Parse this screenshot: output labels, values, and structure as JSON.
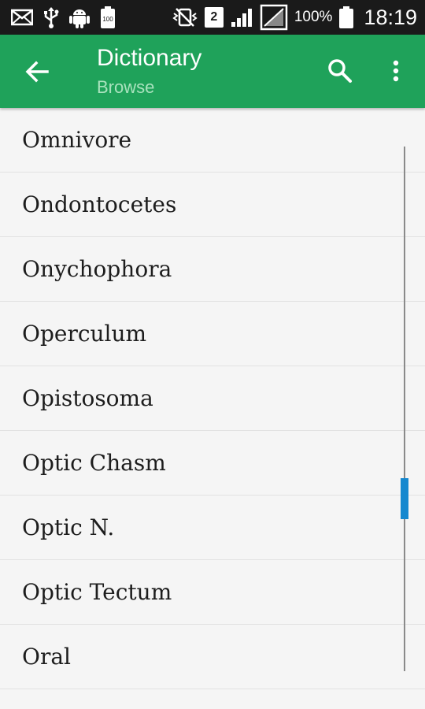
{
  "status_bar": {
    "battery_saver_label": "100",
    "sim_slot": "2",
    "battery_percent": "100%",
    "time": "18:19",
    "icons": [
      "mail-icon",
      "usb-icon",
      "android-icon",
      "battery-saver-icon",
      "mute-vibrate-icon",
      "sim-icon",
      "signal-icon",
      "no-signal-icon",
      "battery-icon"
    ]
  },
  "app_bar": {
    "title": "Dictionary",
    "subtitle": "Browse",
    "color": "#1fa25a",
    "icons": [
      "back-arrow-icon",
      "search-icon",
      "more-vert-icon"
    ]
  },
  "list": {
    "items": [
      "Omnivore",
      "Ondontocetes",
      "Onychophora",
      "Operculum",
      "Opistosoma",
      "Optic Chasm",
      "Optic N.",
      "Optic Tectum",
      "Oral"
    ]
  },
  "scrollbar": {
    "position_fraction": 0.63,
    "color": "#1588cf"
  }
}
